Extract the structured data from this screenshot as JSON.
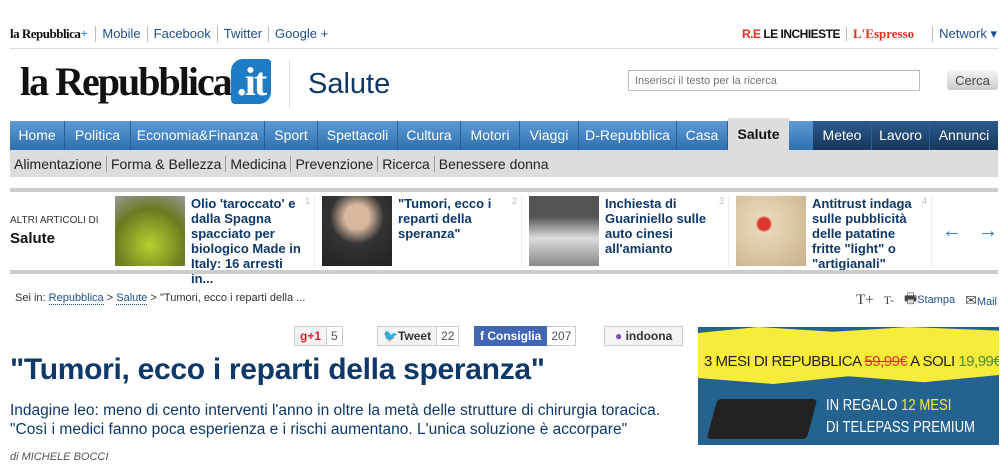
{
  "top": {
    "logo": "la Repubblica+",
    "links": [
      "Mobile",
      "Facebook",
      "Twitter",
      "Google +"
    ],
    "inchieste": "R.E LE INCHIESTE",
    "espresso": "L'Espresso",
    "network": "Network ▾"
  },
  "header": {
    "logo": "la Repubblica",
    "logo_suffix": ".it",
    "section": "Salute",
    "search_placeholder": "Inserisci il testo per la ricerca",
    "search_button": "Cerca"
  },
  "nav": {
    "items": [
      "Home",
      "Politica",
      "Economia&Finanza",
      "Sport",
      "Spettacoli",
      "Cultura",
      "Motori",
      "Viaggi",
      "D-Repubblica",
      "Casa",
      "Salute"
    ],
    "active": "Salute",
    "right": [
      "Meteo",
      "Lavoro",
      "Annunci"
    ]
  },
  "subnav": [
    "Alimentazione",
    "Forma & Bellezza",
    "Medicina",
    "Prevenzione",
    "Ricerca",
    "Benessere donna"
  ],
  "carousel": {
    "label": "ALTRI ARTICOLI DI",
    "section": "Salute",
    "items": [
      {
        "n": "1",
        "title": "Olio 'taroccato' e dalla Spagna spacciato per biologico Made in Italy: 16 arresti in..."
      },
      {
        "n": "2",
        "title": "\"Tumori, ecco i reparti della speranza\""
      },
      {
        "n": "3",
        "title": "Inchiesta di Guariniello sulle auto cinesi all'amianto"
      },
      {
        "n": "4",
        "title": "Antitrust indaga sulle pubblicità delle patatine fritte \"light\" o \"artigianali\""
      }
    ]
  },
  "breadcrumb": {
    "prefix": "Sei in:",
    "items": [
      "Repubblica",
      "Salute"
    ],
    "current": "\"Tumori, ecco i reparti della ..."
  },
  "tools": {
    "increase": "T+",
    "decrease": "T-",
    "print": "Stampa",
    "mail": "Mail"
  },
  "social": {
    "gplus": "g+1",
    "gplus_count": "5",
    "tweet": "Tweet",
    "tweet_count": "22",
    "fb": "Consiglia",
    "fb_count": "207",
    "indoona": "indoona"
  },
  "article": {
    "title": "\"Tumori, ecco i reparti della speranza\"",
    "summary1": "Indagine leo:  meno di cento interventi l'anno in oltre la metà delle strutture di chirurgia toracica.",
    "summary2": "\"Così i medici fanno poca esperienza e i rischi aumentano. L'unica soluzione è accorpare\"",
    "byline": "di MICHELE BOCCI"
  },
  "ad": {
    "l1a": "3 MESI DI REPUBBLICA",
    "old": "59,99€",
    "l1b": "A SOLI",
    "new": "19,99€",
    "l2a": "IN REGALO",
    "l2b": "12 MESI",
    "l3": "DI TELEPASS PREMIUM"
  },
  "colors": {
    "nav": "#3a7dbf",
    "title": "#0d3868",
    "ad_yellow": "#f7ec3a",
    "ad_blue": "#24628f"
  }
}
